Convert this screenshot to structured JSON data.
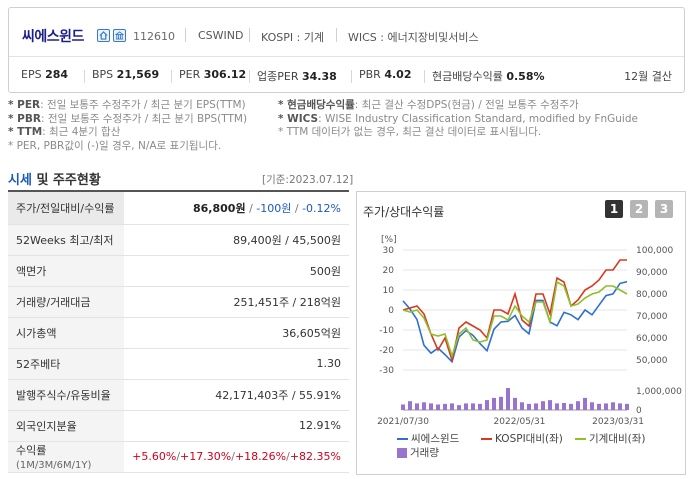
{
  "header": {
    "company": "씨에스윈드",
    "code": "112610",
    "english_name": "CSWIND",
    "market": "KOSPI : 기계",
    "wics": "WICS : 에너지장비및서비스",
    "metrics": [
      {
        "label": "EPS",
        "value": "284"
      },
      {
        "label": "BPS",
        "value": "21,569"
      },
      {
        "label": "PER",
        "value": "306.12"
      },
      {
        "label": "업종PER",
        "value": "34.38"
      },
      {
        "label": "PBR",
        "value": "4.02"
      },
      {
        "label": "현금배당수익률",
        "value": "0.58%"
      }
    ],
    "settlement": "12월 결산"
  },
  "notes": {
    "left": [
      {
        "key": "* PER",
        "text": ": 전일 보통주 수정주가 / 최근 분기 EPS(TTM)"
      },
      {
        "key": "* PBR",
        "text": ": 전일 보통주 수정주가 / 최근 분기 BPS(TTM)"
      },
      {
        "key": "* TTM",
        "text": ": 최근 4분기 합산"
      },
      {
        "key": "",
        "text": "* PER, PBR값이 (-)일 경우, N/A로 표기됩니다."
      }
    ],
    "right": [
      {
        "key": "* 현금배당수익률",
        "text": ": 최근 결산 수정DPS(현금) / 전일 보통주 수정주가"
      },
      {
        "key": "* WICS",
        "text": ": WISE Industry Classification Standard, modified by FnGuide"
      },
      {
        "key": "",
        "text": "* TTM 데이터가 없는 경우, 최근 결산 데이터로 표시됩니다."
      }
    ]
  },
  "section": {
    "title_hl": "시세",
    "title_rest": " 및 주주현황",
    "date": "[기준:2023.07.12]"
  },
  "table": {
    "rows": [
      {
        "label": "주가/전일대비/수익률",
        "price": "86,800원",
        "sep": " / ",
        "change": "-100원",
        "sep2": " / ",
        "rate": "-0.12%"
      },
      {
        "label": "52Weeks 최고/최저",
        "value": "89,400원 / 45,500원"
      },
      {
        "label": "액면가",
        "value": "500원"
      },
      {
        "label": "거래량/거래대금",
        "value": "251,451주 / 218억원"
      },
      {
        "label": "시가총액",
        "value": "36,605억원"
      },
      {
        "label": "52주베타",
        "value": "1.30"
      },
      {
        "label": "발행주식수/유동비율",
        "value": "42,171,403주 / 55.91%"
      },
      {
        "label": "외국인지분율",
        "value": "12.91%"
      },
      {
        "label": "수익률",
        "label_sub": "(1M/3M/6M/1Y)",
        "returns": [
          "+5.60%",
          "+17.30%",
          "+18.26%",
          "+82.35%"
        ]
      }
    ]
  },
  "chart_panel": {
    "title": "주가/상대수익률",
    "tabs": [
      "1",
      "2",
      "3"
    ],
    "active_tab": 0,
    "legend": {
      "series1": "씨에스윈드",
      "series2": "KOSPI대비(좌)",
      "series3": "기계대비(좌)",
      "volume": "거래량"
    }
  },
  "chart_data": {
    "type": "line",
    "left_axis_unit": "[%]",
    "left_ticks": [
      "30",
      "20",
      "10",
      "0",
      "-10",
      "-20",
      "-30"
    ],
    "right_ticks": [
      "100,000",
      "90,000",
      "80,000",
      "70,000",
      "60,000",
      "50,000"
    ],
    "volume_ticks": [
      "1,000,000",
      "0"
    ],
    "x_ticks": [
      "2021/07/30",
      "2022/05/31",
      "2023/03/31"
    ],
    "ylim_left": [
      -30,
      30
    ],
    "ylim_right": [
      50000,
      100000
    ],
    "series": [
      {
        "name": "씨에스윈드",
        "color": "#2d6fd4",
        "axis": "right",
        "values": [
          78800,
          75400,
          71000,
          60300,
          57000,
          59100,
          56400,
          53400,
          63700,
          66400,
          64400,
          61000,
          58000,
          67000,
          70000,
          70300,
          72700,
          67500,
          65100,
          79000,
          79000,
          70000,
          68400,
          74000,
          73000,
          71000,
          75000,
          73000,
          77000,
          81000,
          81700,
          86100,
          86800
        ]
      },
      {
        "name": "KOSPI대비(좌)",
        "color": "#d9381e",
        "axis": "left",
        "values": [
          0,
          1,
          2,
          -2,
          -12,
          -20,
          -14,
          -25,
          -9,
          -6,
          -8,
          -10,
          -14,
          0,
          0,
          -2,
          8,
          -5,
          -8,
          8,
          8,
          -2,
          16,
          14,
          2,
          5,
          10,
          12,
          15,
          20,
          20,
          25,
          25
        ]
      },
      {
        "name": "기계대비(좌)",
        "color": "#8fbf2a",
        "axis": "left",
        "values": [
          0,
          -1,
          0,
          -4,
          -12,
          -13,
          -12,
          -23,
          -12,
          -9,
          -15,
          -16,
          -15,
          -3,
          -3,
          -5,
          2,
          -3,
          -6,
          4,
          4,
          -6,
          14,
          12,
          2,
          3,
          6,
          8,
          9,
          12,
          12,
          10,
          8
        ]
      }
    ],
    "volume": {
      "name": "거래량",
      "color": "#9a73cf",
      "values": [
        0.25,
        0.4,
        0.3,
        0.35,
        0.3,
        0.25,
        0.28,
        0.3,
        0.22,
        0.3,
        0.3,
        0.28,
        0.45,
        0.55,
        0.6,
        1.0,
        0.55,
        0.35,
        0.28,
        0.3,
        0.4,
        0.45,
        0.3,
        0.32,
        0.28,
        0.4,
        0.55,
        0.35,
        0.28,
        0.3,
        0.35,
        0.3,
        0.28
      ]
    },
    "volume_max": 1000000
  }
}
